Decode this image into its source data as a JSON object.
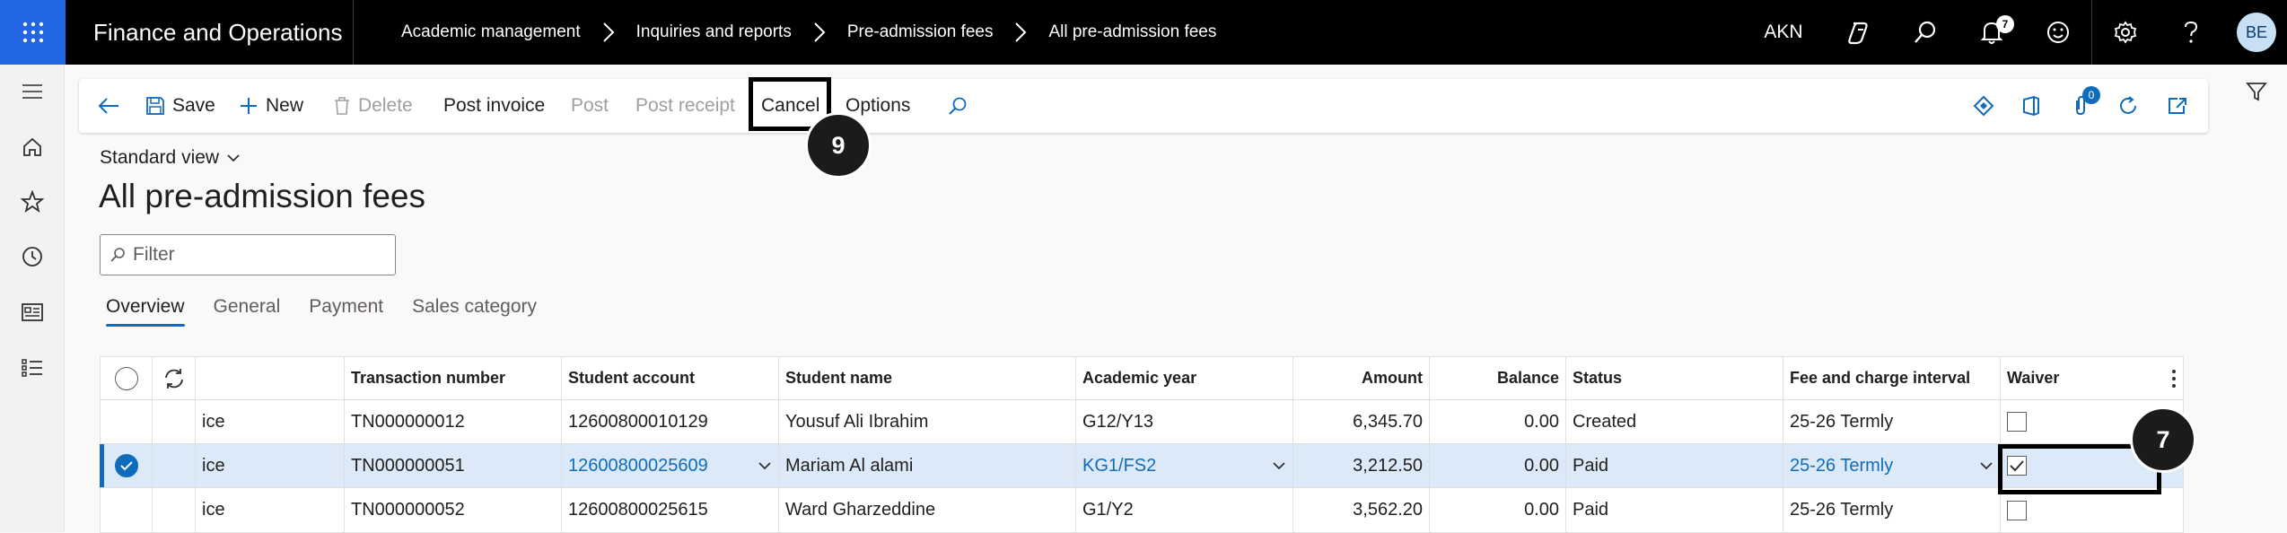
{
  "topbar": {
    "app_title": "Finance and Operations",
    "breadcrumb": [
      "Academic management",
      "Inquiries and reports",
      "Pre-admission fees",
      "All pre-admission fees"
    ],
    "company": "AKN",
    "notification_count": "7",
    "avatar_initials": "BE"
  },
  "actionpane": {
    "save": "Save",
    "new": "New",
    "delete": "Delete",
    "post_invoice": "Post invoice",
    "post": "Post",
    "post_receipt": "Post receipt",
    "cancel": "Cancel",
    "options": "Options",
    "attachments_count": "0"
  },
  "callouts": {
    "cancel_step": "9",
    "waiver_step": "7"
  },
  "page": {
    "view": "Standard view",
    "title": "All pre-admission fees",
    "filter_placeholder": "Filter",
    "tabs": [
      "Overview",
      "General",
      "Payment",
      "Sales category"
    ]
  },
  "grid": {
    "columns": {
      "transaction_number": "Transaction number",
      "student_account": "Student account",
      "student_name": "Student name",
      "academic_year": "Academic year",
      "amount": "Amount",
      "balance": "Balance",
      "status": "Status",
      "fee_interval": "Fee and charge interval",
      "waiver": "Waiver"
    },
    "rows": [
      {
        "type": "ice",
        "transaction_number": "TN000000012",
        "student_account": "12600800010129",
        "student_name": "Yousuf Ali Ibrahim",
        "academic_year": "G12/Y13",
        "amount": "6,345.70",
        "balance": "0.00",
        "status": "Created",
        "fee_interval": "25-26 Termly",
        "waiver": false
      },
      {
        "type": "ice",
        "transaction_number": "TN000000051",
        "student_account": "12600800025609",
        "student_name": "Mariam Al alami",
        "academic_year": "KG1/FS2",
        "amount": "3,212.50",
        "balance": "0.00",
        "status": "Paid",
        "fee_interval": "25-26 Termly",
        "waiver": true
      },
      {
        "type": "ice",
        "transaction_number": "TN000000052",
        "student_account": "12600800025615",
        "student_name": "Ward Gharzeddine",
        "academic_year": "G1/Y2",
        "amount": "3,562.20",
        "balance": "0.00",
        "status": "Paid",
        "fee_interval": "25-26 Termly",
        "waiver": false
      }
    ]
  },
  "colors": {
    "accent": "#0f6cbd",
    "waffle": "#2266e3",
    "selected_row": "#dce9f9"
  }
}
